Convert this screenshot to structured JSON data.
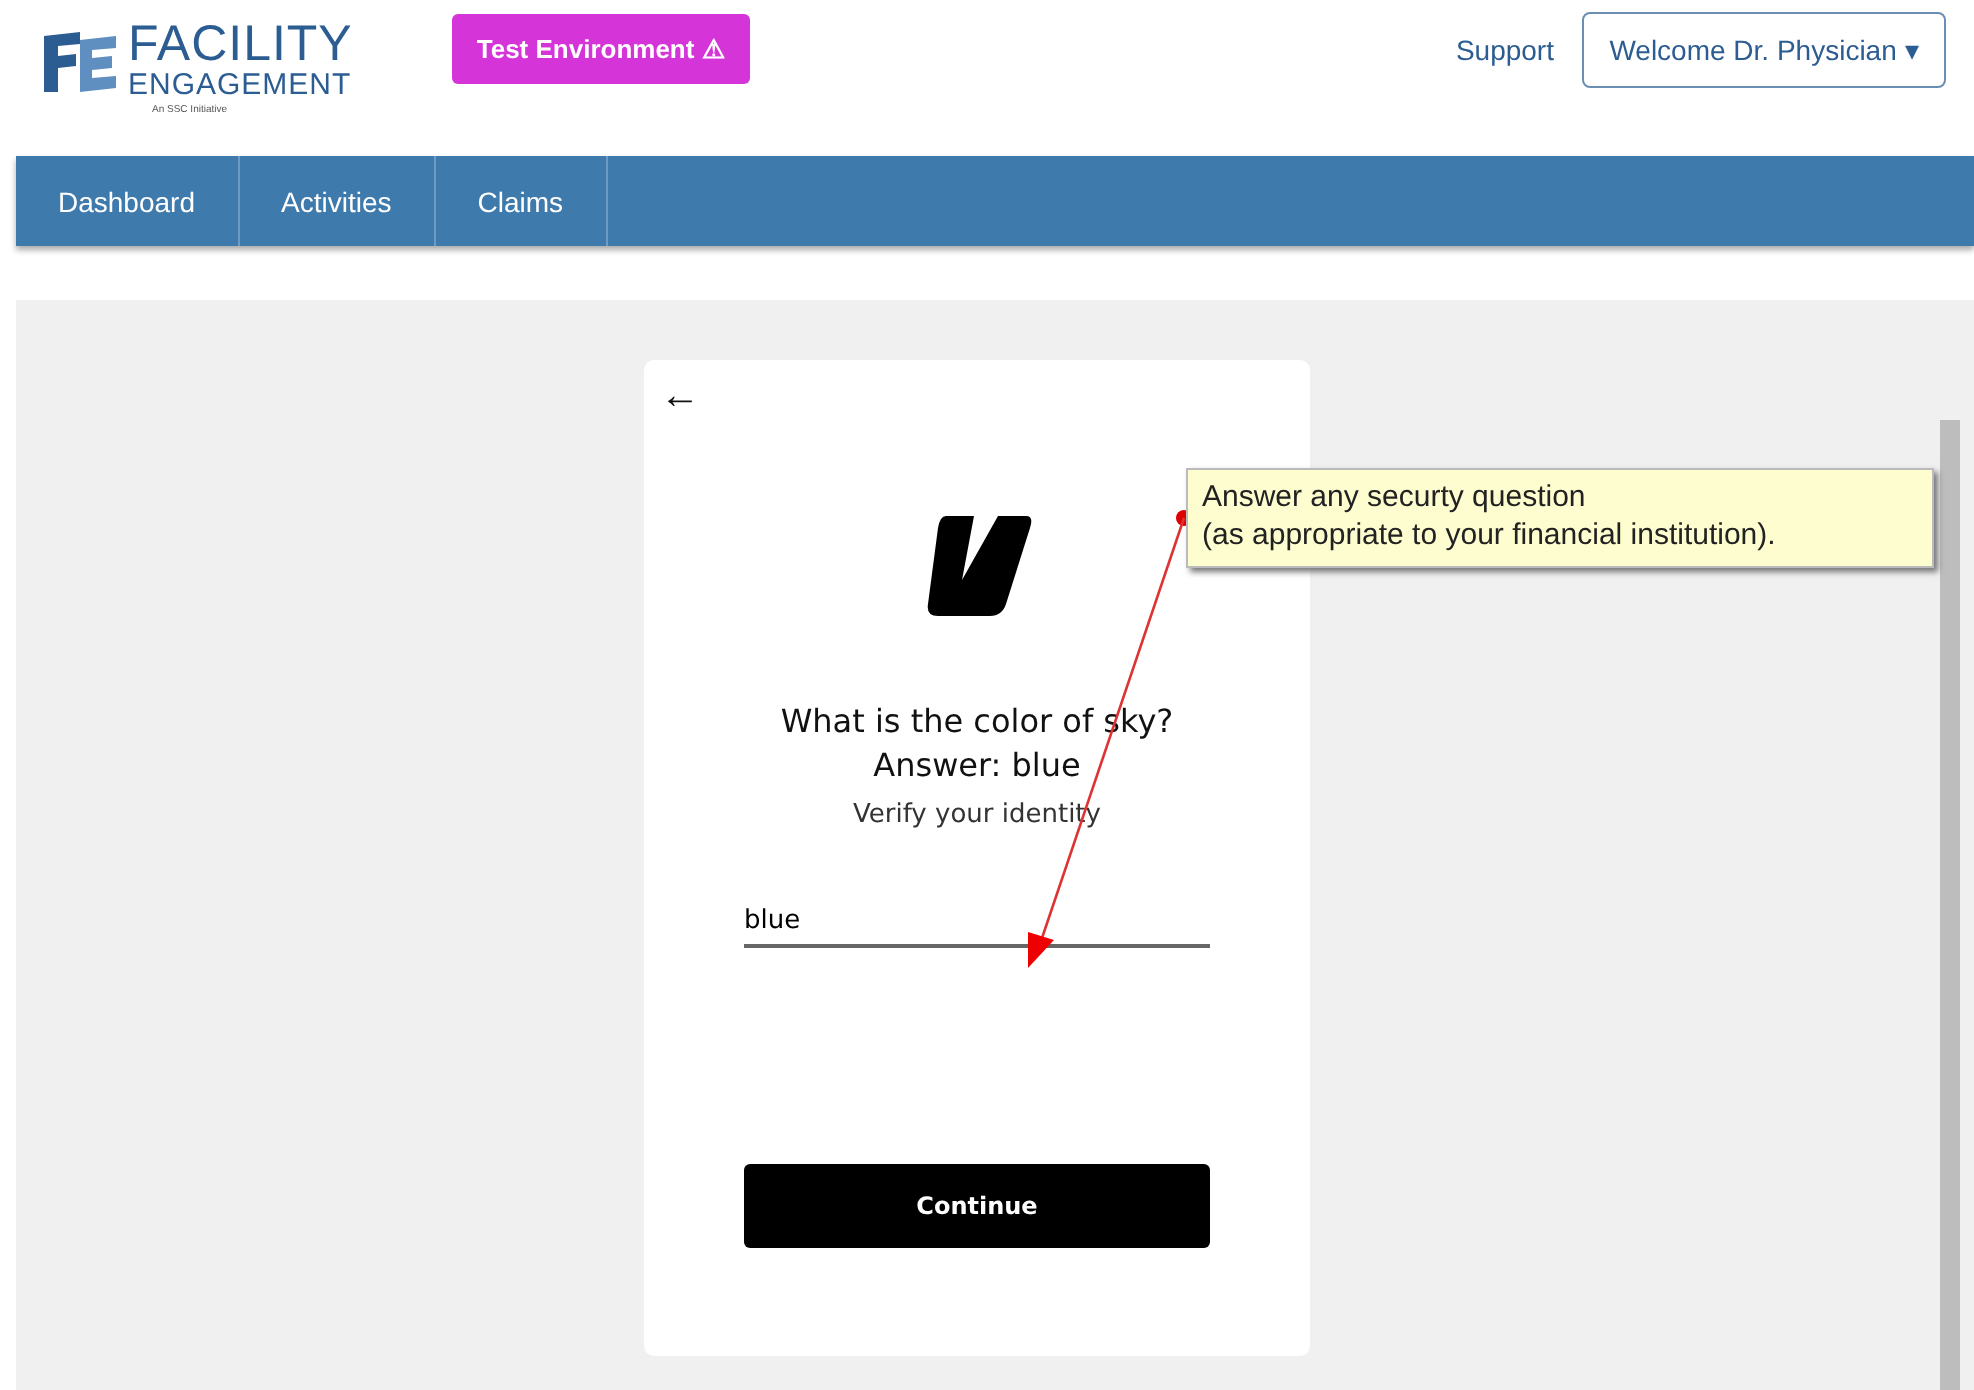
{
  "header": {
    "logo": {
      "title": "FACILITY",
      "subtitle": "ENGAGEMENT",
      "tagline": "An SSC Initiative"
    },
    "env_badge": {
      "label": "Test Environment",
      "icon": "⚠"
    },
    "support_link": "Support",
    "user_menu": {
      "label": "Welcome Dr. Physician",
      "caret": "▾"
    }
  },
  "nav": {
    "items": [
      {
        "label": "Dashboard"
      },
      {
        "label": "Activities"
      },
      {
        "label": "Claims"
      }
    ]
  },
  "card": {
    "back": "←",
    "question": "What is the color of sky?",
    "answer_hint": "Answer: blue",
    "subtitle": "Verify your identity",
    "field": {
      "value": "blue"
    },
    "button": "Continue"
  },
  "callout": {
    "lines": [
      "Answer any securty question",
      "(as appropriate to your financial institution)."
    ]
  }
}
